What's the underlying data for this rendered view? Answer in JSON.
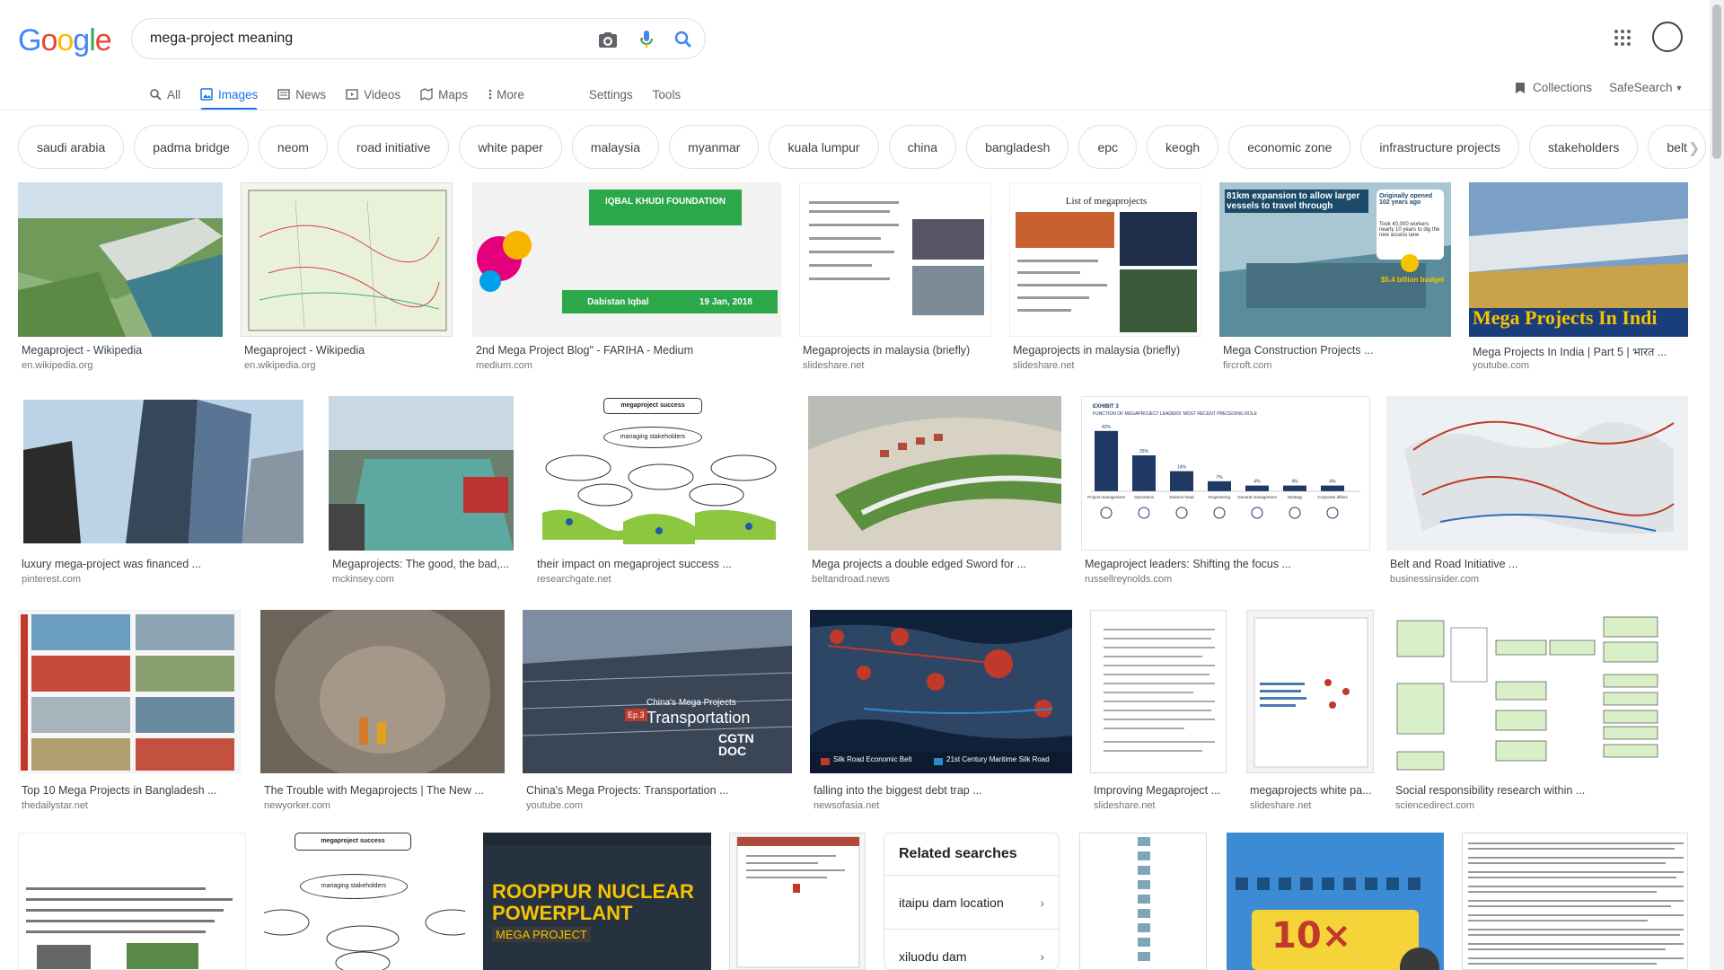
{
  "logo": {
    "letters": [
      "G",
      "o",
      "o",
      "g",
      "l",
      "e"
    ]
  },
  "search": {
    "query": "mega-project meaning"
  },
  "tabs": [
    {
      "label": "All",
      "icon": "search-icon"
    },
    {
      "label": "Images",
      "icon": "image-icon",
      "active": true
    },
    {
      "label": "News",
      "icon": "news-icon"
    },
    {
      "label": "Videos",
      "icon": "video-icon"
    },
    {
      "label": "Maps",
      "icon": "map-icon"
    },
    {
      "label": "More",
      "icon": "more-vert-icon"
    }
  ],
  "tools": {
    "settings": "Settings",
    "tools": "Tools"
  },
  "right_nav": {
    "collections": "Collections",
    "safesearch": "SafeSearch"
  },
  "chips": [
    "saudi arabia",
    "padma bridge",
    "neom",
    "road initiative",
    "white paper",
    "malaysia",
    "myanmar",
    "kuala lumpur",
    "china",
    "bangladesh",
    "epc",
    "keogh",
    "economic zone",
    "infrastructure projects",
    "stakeholders",
    "belt"
  ],
  "images": {
    "r1": [
      {
        "caption": "Megaproject - Wikipedia",
        "domain": "en.wikipedia.org"
      },
      {
        "caption": "Megaproject - Wikipedia",
        "domain": "en.wikipedia.org"
      },
      {
        "caption": "2nd Mega Project Blog\" - FARIHA - Medium",
        "domain": "medium.com"
      },
      {
        "caption": "Megaprojects in malaysia (briefly)",
        "domain": "slideshare.net"
      },
      {
        "caption": "Megaprojects in malaysia (briefly)",
        "domain": "slideshare.net"
      },
      {
        "caption": "Mega Construction Projects ...",
        "domain": "fircroft.com"
      },
      {
        "caption": "Mega Projects In India | Part 5 | भारत ...",
        "domain": "youtube.com"
      }
    ],
    "r2": [
      {
        "caption": "luxury mega-project was financed ...",
        "domain": "pinterest.com"
      },
      {
        "caption": "Megaprojects: The good, the bad,...",
        "domain": "mckinsey.com"
      },
      {
        "caption": "their impact on megaproject success ...",
        "domain": "researchgate.net"
      },
      {
        "caption": "Mega projects a double edged Sword for ...",
        "domain": "beltandroad.news"
      },
      {
        "caption": "Megaproject leaders: Shifting the focus ...",
        "domain": "russellreynolds.com"
      },
      {
        "caption": "Belt and Road Initiative ...",
        "domain": "businessinsider.com"
      }
    ],
    "r3": [
      {
        "caption": "Top 10 Mega Projects in Bangladesh ...",
        "domain": "thedailystar.net"
      },
      {
        "caption": "The Trouble with Megaprojects | The New ...",
        "domain": "newyorker.com"
      },
      {
        "caption": "China's Mega Projects: Transportation ...",
        "domain": "youtube.com"
      },
      {
        "caption": "falling into the biggest debt trap ...",
        "domain": "newsofasia.net"
      },
      {
        "caption": "Improving Megaproject ...",
        "domain": "slideshare.net"
      },
      {
        "caption": "megaprojects white pa...",
        "domain": "slideshare.net"
      },
      {
        "caption": "Social responsibility research within ...",
        "domain": "sciencedirect.com"
      }
    ]
  },
  "image_text": {
    "iqbal_foundation": "IQBAL KHUDI FOUNDATION",
    "dabistan": "Dabistan Iqbal",
    "dabistan_date": "19 Jan, 2018",
    "list_of_megaprojects": "List of megaprojects",
    "fircroft_headline": "81km expansion to allow larger vessels to travel through",
    "fircroft_opened": "Originally opened 102 years ago",
    "fircroft_workers": "Took 40,000 workers nearly 10 years to dig the new access lane",
    "fircroft_budget": "$5.4 billion budget",
    "india_banner": "Mega Projects In Indi",
    "exhibit": "EXHIBIT 3",
    "exhibit_title": "FUNCTION OF MEGAPROJECT LEADERS' MOST RECENT PRECEDING ROLE",
    "managing_stakeholders": "managing stakeholders",
    "megaproject_success": "megaproject success",
    "cgtn_title": "China's Mega Projects",
    "cgtn_sub": "Transportation",
    "cgtn_ep": "Ep.3",
    "cgtn_doc": "CGTN DOC",
    "map_legend_1": "Silk Road Economic Belt",
    "map_legend_2": "21st Century Maritime Silk Road",
    "rooppur_title": "ROOPPUR NUCLEAR POWERPLANT",
    "rooppur_sub": "MEGA PROJECT",
    "ten_x": "10×"
  },
  "exhibit_bars": {
    "categories": [
      "Project management",
      "Operations",
      "Division head",
      "Engineering",
      "General management",
      "Strategy",
      "Corporate affairs"
    ],
    "values": [
      42,
      25,
      14,
      7,
      4,
      4,
      4
    ],
    "labels": [
      "42%",
      "25%",
      "14%",
      "7%",
      "4%",
      "4%",
      "4%"
    ]
  },
  "related": {
    "title": "Related searches",
    "items": [
      "itaipu dam location",
      "xiluodu dam"
    ]
  },
  "colors": {
    "accent": "#1a73e8",
    "blue": "#4285f4",
    "red": "#ea4335",
    "yellow": "#fbbc05",
    "green": "#34a853"
  }
}
